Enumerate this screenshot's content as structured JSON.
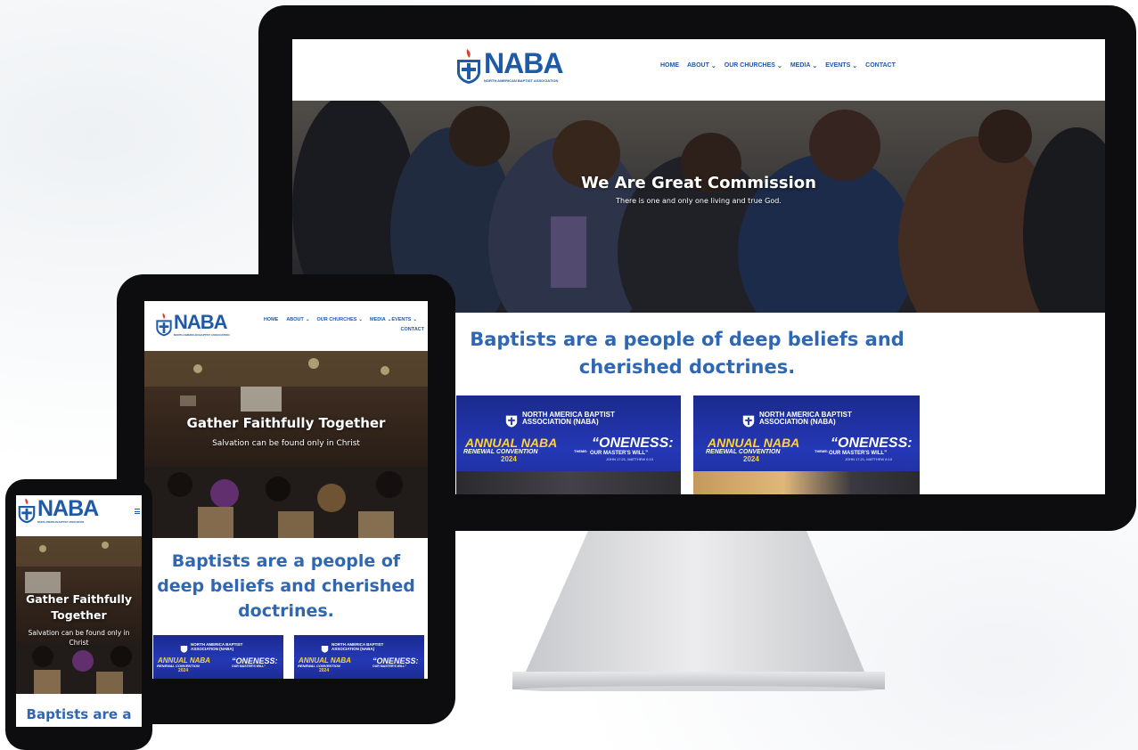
{
  "brand": {
    "name": "NABA",
    "tagline": "NORTH AMERICAN BAPTIST ASSOCIATION"
  },
  "nav": {
    "items": [
      {
        "label": "HOME"
      },
      {
        "label": "ABOUT"
      },
      {
        "label": "OUR CHURCHES"
      },
      {
        "label": "MEDIA"
      },
      {
        "label": "EVENTS"
      },
      {
        "label": "CONTACT"
      }
    ]
  },
  "desktop": {
    "hero_title": "We Are Great Commission",
    "hero_subtitle": "There is one and only one living and true God.",
    "heading": "Baptists are a people of deep beliefs and cherished doctrines."
  },
  "tablet": {
    "hero_title": "Gather Faithfully Together",
    "hero_subtitle": "Salvation can be found only in Christ",
    "heading": "Baptists are a people of deep beliefs and cherished doctrines."
  },
  "phone": {
    "hero_title": "Gather Faithfully Together",
    "hero_subtitle": "Salvation can be found only in Christ",
    "heading": "Baptists are a"
  },
  "event_card": {
    "org_line1": "NORTH AMERICA BAPTIST",
    "org_line2": "ASSOCIATION (NABA)",
    "annual": "ANNUAL NABA",
    "renewal": "RENEWAL CONVENTION",
    "year": "2024",
    "theme_label": "THEME:",
    "theme_quote": "“ONENESS:",
    "theme_sub": "OUR MASTER'S WILL”",
    "scripture": "JOHN 17:21, MATTHEW 6:10"
  },
  "colors": {
    "brand_blue": "#1f5aa6",
    "heading_blue": "#2f67b3",
    "card_blue": "#2438b6",
    "card_yellow": "#ffd23e",
    "logo_red": "#e23a2e"
  },
  "icons": [
    "naba-logo-icon",
    "chevron-down-icon",
    "hamburger-menu-icon"
  ]
}
